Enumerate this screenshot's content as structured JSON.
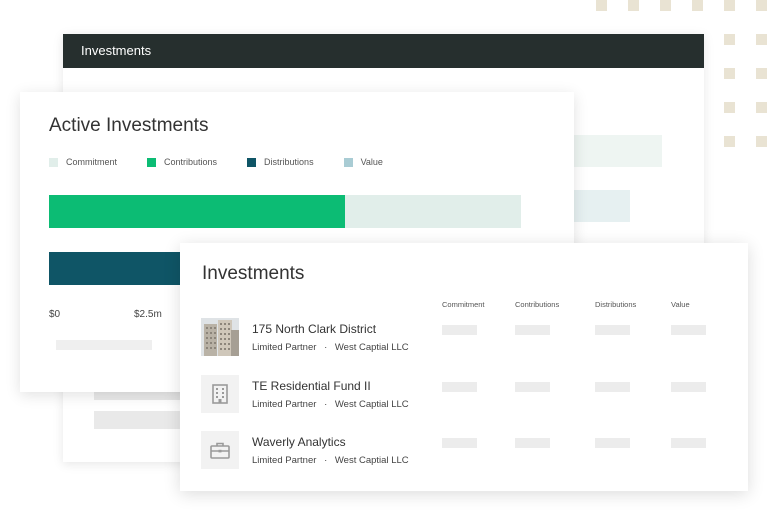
{
  "back_window": {
    "title": "Investments"
  },
  "active_investments": {
    "title": "Active Investments",
    "legend": [
      {
        "label": "Commitment",
        "color": "#e1eeea"
      },
      {
        "label": "Contributions",
        "color": "#0cbc74"
      },
      {
        "label": "Distributions",
        "color": "#0f5566"
      },
      {
        "label": "Value",
        "color": "#a9ccd4"
      }
    ],
    "bars": {
      "commitment_fraction": 0.91,
      "contributions_fraction": 0.57,
      "distributions_fraction": 0.3
    },
    "axis_ticks": [
      "$0",
      "$2.5m"
    ]
  },
  "investments": {
    "title": "Investments",
    "columns": [
      "Commitment",
      "Contributions",
      "Distributions",
      "Value"
    ],
    "rows": [
      {
        "name": "175 North Clark District",
        "role": "Limited Partner",
        "separator": "·",
        "entity": "West Captial LLC",
        "icon": "building-photo"
      },
      {
        "name": "TE Residential Fund II",
        "role": "Limited Partner",
        "separator": "·",
        "entity": "West Captial LLC",
        "icon": "office-building-icon"
      },
      {
        "name": "Waverly Analytics",
        "role": "Limited Partner",
        "separator": "·",
        "entity": "West Captial LLC",
        "icon": "briefcase-icon"
      }
    ]
  },
  "colors": {
    "header_bg": "#262f2e",
    "accent_green": "#0cbc74",
    "accent_teal": "#0f5566",
    "dot": "#e9e3d3"
  }
}
